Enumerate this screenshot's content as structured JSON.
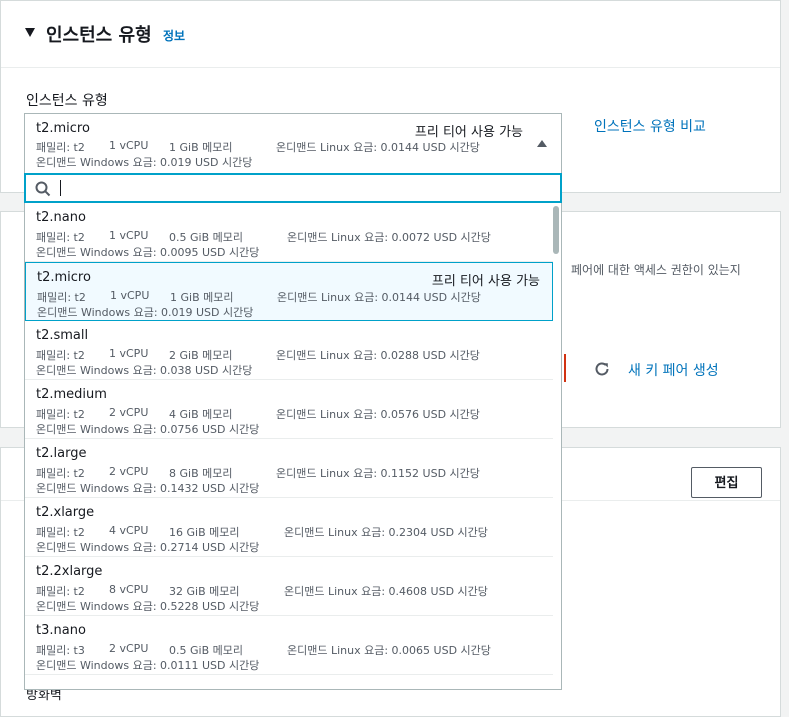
{
  "instance_section": {
    "title": "인스턴스 유형",
    "info": "정보",
    "field_label": "인스턴스 유형",
    "compare_link": "인스턴스 유형 비교",
    "selected": {
      "name": "t2.micro",
      "tier": "프리 티어 사용 가능",
      "family": "패밀리: t2",
      "vcpu": "1 vCPU",
      "memory": "1 GiB 메모리",
      "linux": "온디맨드 Linux 요금: 0.0144 USD 시간당",
      "windows": "온디맨드 Windows 요금: 0.019 USD 시간당"
    },
    "search": {
      "value": "",
      "placeholder": ""
    }
  },
  "options": [
    {
      "name": "t2.nano",
      "tier": "",
      "family": "패밀리: t2",
      "vcpu": "1 vCPU",
      "memory": "0.5 GiB 메모리",
      "linux": "온디맨드 Linux 요금: 0.0072 USD 시간당",
      "windows": "온디맨드 Windows 요금: 0.0095 USD 시간당"
    },
    {
      "name": "t2.micro",
      "tier": "프리 티어 사용 가능",
      "family": "패밀리: t2",
      "vcpu": "1 vCPU",
      "memory": "1 GiB 메모리",
      "linux": "온디맨드 Linux 요금: 0.0144 USD 시간당",
      "windows": "온디맨드 Windows 요금: 0.019 USD 시간당"
    },
    {
      "name": "t2.small",
      "tier": "",
      "family": "패밀리: t2",
      "vcpu": "1 vCPU",
      "memory": "2 GiB 메모리",
      "linux": "온디맨드 Linux 요금: 0.0288 USD 시간당",
      "windows": "온디맨드 Windows 요금: 0.038 USD 시간당"
    },
    {
      "name": "t2.medium",
      "tier": "",
      "family": "패밀리: t2",
      "vcpu": "2 vCPU",
      "memory": "4 GiB 메모리",
      "linux": "온디맨드 Linux 요금: 0.0576 USD 시간당",
      "windows": "온디맨드 Windows 요금: 0.0756 USD 시간당"
    },
    {
      "name": "t2.large",
      "tier": "",
      "family": "패밀리: t2",
      "vcpu": "2 vCPU",
      "memory": "8 GiB 메모리",
      "linux": "온디맨드 Linux 요금: 0.1152 USD 시간당",
      "windows": "온디맨드 Windows 요금: 0.1432 USD 시간당"
    },
    {
      "name": "t2.xlarge",
      "tier": "",
      "family": "패밀리: t2",
      "vcpu": "4 vCPU",
      "memory": "16 GiB 메모리",
      "linux": "온디맨드 Linux 요금: 0.2304 USD 시간당",
      "windows": "온디맨드 Windows 요금: 0.2714 USD 시간당"
    },
    {
      "name": "t2.2xlarge",
      "tier": "",
      "family": "패밀리: t2",
      "vcpu": "8 vCPU",
      "memory": "32 GiB 메모리",
      "linux": "온디맨드 Linux 요금: 0.4608 USD 시간당",
      "windows": "온디맨드 Windows 요금: 0.5228 USD 시간당"
    },
    {
      "name": "t3.nano",
      "tier": "",
      "family": "패밀리: t3",
      "vcpu": "2 vCPU",
      "memory": "0.5 GiB 메모리",
      "linux": "온디맨드 Linux 요금: 0.0065 USD 시간당",
      "windows": "온디맨드 Windows 요금: 0.0111 USD 시간당"
    }
  ],
  "keypair_section": {
    "partial_text": "페어에 대한 액세스 권한이 있는지",
    "create_link": "새 키 페어 생성"
  },
  "network_section": {
    "edit_button": "편집",
    "partial_label": "방화벽"
  },
  "colors": {
    "accent": "#00a1c9",
    "link": "#0073bb",
    "error": "#d13212",
    "selected_bg": "#f1faff"
  },
  "icons": [
    "collapse-caret-icon",
    "caret-up-icon",
    "search-icon",
    "refresh-icon"
  ]
}
